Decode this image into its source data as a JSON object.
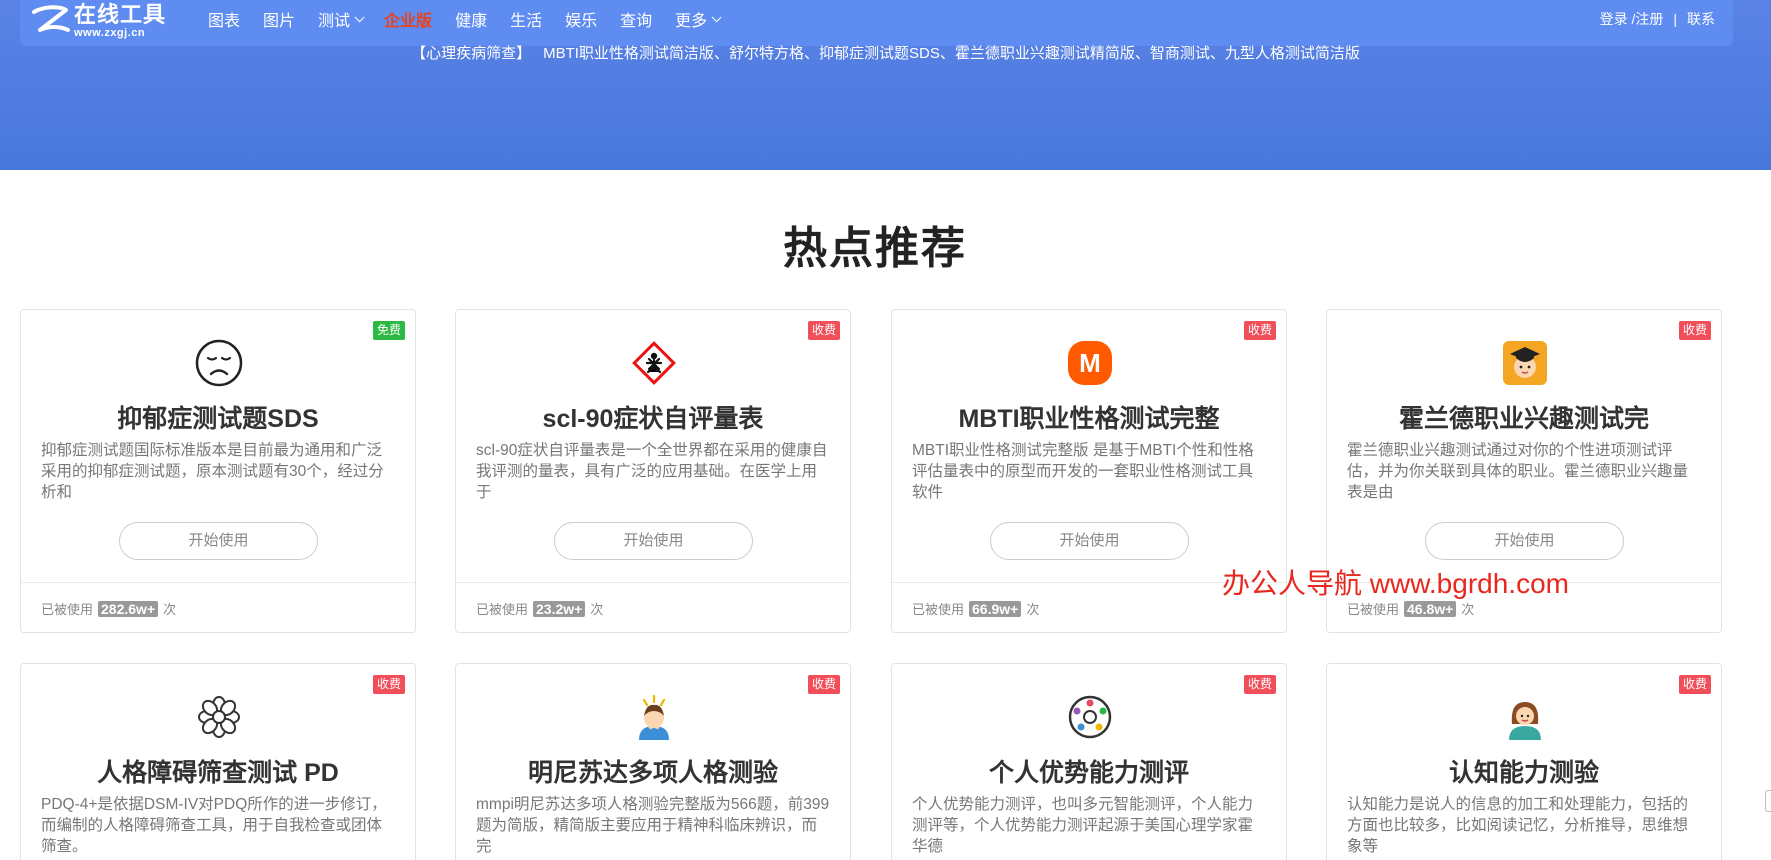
{
  "header": {
    "logo": {
      "title": "在线工具",
      "url": "www.zxgj.cn"
    },
    "nav": [
      {
        "label": "图表",
        "dropdown": false
      },
      {
        "label": "图片",
        "dropdown": false
      },
      {
        "label": "测试",
        "dropdown": true
      },
      {
        "label": "企业版",
        "dropdown": false,
        "active": true
      },
      {
        "label": "健康",
        "dropdown": false
      },
      {
        "label": "生活",
        "dropdown": false
      },
      {
        "label": "娱乐",
        "dropdown": false
      },
      {
        "label": "查询",
        "dropdown": false
      },
      {
        "label": "更多",
        "dropdown": true
      }
    ],
    "login": "登录 /注册",
    "separator": "|",
    "contact": "联系"
  },
  "quick_links": {
    "category": "【心理疾病筛查】",
    "items": [
      "MBTI职业性格测试简洁版",
      "舒尔特方格",
      "抑郁症测试题SDS",
      "霍兰德职业兴趣测试精简版",
      "智商测试",
      "九型人格测试简洁版"
    ],
    "joiner": "、"
  },
  "section_title": "热点推荐",
  "cards": [
    {
      "title": "抑郁症测试题SDS",
      "badge": "免费",
      "badge_type": "free",
      "icon": "sad-face-icon",
      "desc": "抑郁症测试题国际标准版本是目前最为通用和广泛采用的抑郁症测试题，原本测试题有30个，经过分析和",
      "button": "开始使用",
      "used_prefix": "已被使用",
      "used_count": "282.6w+",
      "used_suffix": "次"
    },
    {
      "title": "scl-90症状自评量表",
      "badge": "收费",
      "badge_type": "paid",
      "icon": "health-hazard-icon",
      "desc": "scl-90症状自评量表是一个全世界都在采用的健康自我评测的量表，具有广泛的应用基础。在医学上用于",
      "button": "开始使用",
      "used_prefix": "已被使用",
      "used_count": "23.2w+",
      "used_suffix": "次"
    },
    {
      "title": "MBTI职业性格测试完整",
      "badge": "收费",
      "badge_type": "paid",
      "icon": "m-logo-icon",
      "icon_letter": "M",
      "desc": "MBTI职业性格测试完整版 是基于MBTI个性和性格评估量表中的原型而开发的一套职业性格测试工具软件",
      "button": "开始使用",
      "used_prefix": "已被使用",
      "used_count": "66.9w+",
      "used_suffix": "次"
    },
    {
      "title": "霍兰德职业兴趣测试完",
      "badge": "收费",
      "badge_type": "paid",
      "icon": "graduate-avatar-icon",
      "desc": "霍兰德职业兴趣测试通过对你的个性进项测试评估，并为你关联到具体的职业。霍兰德职业兴趣量表是由",
      "button": "开始使用",
      "used_prefix": "已被使用",
      "used_count": "46.8w+",
      "used_suffix": "次"
    },
    {
      "title": "人格障碍筛查测试 PD",
      "badge": "收费",
      "badge_type": "paid",
      "icon": "flower-icon",
      "desc": "PDQ-4+是依据DSM-IV对PDQ所作的进一步修订，而编制的人格障碍筛查工具，用于自我检查或团体筛查。"
    },
    {
      "title": "明尼苏达多项人格测验",
      "badge": "收费",
      "badge_type": "paid",
      "icon": "stressed-person-icon",
      "desc": "mmpi明尼苏达多项人格测验完整版为566题，前399题为简版，精简版主要应用于精神科临床辨识，而完"
    },
    {
      "title": "个人优势能力测评",
      "badge": "收费",
      "badge_type": "paid",
      "icon": "people-circle-icon",
      "desc": "个人优势能力测评，也叫多元智能测评，个人能力测评等，个人优势能力测评起源于美国心理学家霍华德"
    },
    {
      "title": "认知能力测验",
      "badge": "收费",
      "badge_type": "paid",
      "icon": "woman-avatar-icon",
      "desc": "认知能力是说人的信息的加工和处理能力，包括的方面也比较多，比如阅读记忆，分析推导，思维想象等"
    }
  ],
  "watermark": "办公人导航 www.bgrdh.com",
  "colors": {
    "hero": "#4877dc",
    "navbar": "#5e8cf0",
    "active_nav": "#e8431f",
    "badge_free": "#2bb944",
    "badge_paid": "#f04f5a",
    "watermark": "#e8281e"
  }
}
